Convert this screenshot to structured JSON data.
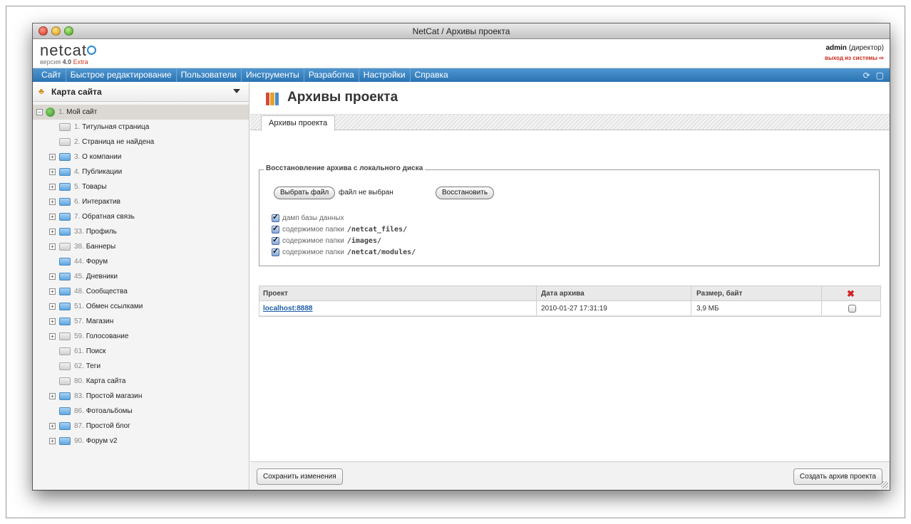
{
  "window": {
    "title": "NetCat / Архивы проекта"
  },
  "header": {
    "logo_text": "netcat",
    "version_prefix": "версия",
    "version_number": "4.0",
    "version_edition": "Extra",
    "user_name": "admin",
    "user_role": "(директор)",
    "logout_label": "выход из системы"
  },
  "menu": {
    "items": [
      "Сайт",
      "Быстрое редактирование",
      "Пользователи",
      "Инструменты",
      "Разработка",
      "Настройки",
      "Справка"
    ],
    "icons": [
      "refresh-icon",
      "chat-icon"
    ]
  },
  "sidebar": {
    "title": "Карта сайта",
    "root": {
      "num": "1.",
      "label": "Мой сайт"
    },
    "items": [
      {
        "num": "1.",
        "label": "Титульная страница",
        "expandable": false,
        "color": "gray"
      },
      {
        "num": "2.",
        "label": "Страница не найдена",
        "expandable": false,
        "color": "gray"
      },
      {
        "num": "3.",
        "label": "О компании",
        "expandable": true,
        "color": "blue"
      },
      {
        "num": "4.",
        "label": "Публикации",
        "expandable": true,
        "color": "blue"
      },
      {
        "num": "5.",
        "label": "Товары",
        "expandable": true,
        "color": "blue"
      },
      {
        "num": "6.",
        "label": "Интерактив",
        "expandable": true,
        "color": "blue"
      },
      {
        "num": "7.",
        "label": "Обратная связь",
        "expandable": true,
        "color": "blue"
      },
      {
        "num": "33.",
        "label": "Профиль",
        "expandable": true,
        "color": "blue"
      },
      {
        "num": "38.",
        "label": "Баннеры",
        "expandable": true,
        "color": "gray"
      },
      {
        "num": "44.",
        "label": "Форум",
        "expandable": false,
        "color": "blue"
      },
      {
        "num": "45.",
        "label": "Дневники",
        "expandable": true,
        "color": "blue"
      },
      {
        "num": "48.",
        "label": "Сообщества",
        "expandable": true,
        "color": "blue"
      },
      {
        "num": "51.",
        "label": "Обмен ссылками",
        "expandable": true,
        "color": "blue"
      },
      {
        "num": "57.",
        "label": "Магазин",
        "expandable": true,
        "color": "blue"
      },
      {
        "num": "59.",
        "label": "Голосование",
        "expandable": true,
        "color": "gray"
      },
      {
        "num": "61.",
        "label": "Поиск",
        "expandable": false,
        "color": "gray"
      },
      {
        "num": "62.",
        "label": "Теги",
        "expandable": false,
        "color": "gray"
      },
      {
        "num": "80.",
        "label": "Карта сайта",
        "expandable": false,
        "color": "gray"
      },
      {
        "num": "83.",
        "label": "Простой магазин",
        "expandable": true,
        "color": "blue"
      },
      {
        "num": "86.",
        "label": "Фотоальбомы",
        "expandable": false,
        "color": "blue"
      },
      {
        "num": "87.",
        "label": "Простой блог",
        "expandable": true,
        "color": "blue"
      },
      {
        "num": "90.",
        "label": "Форум v2",
        "expandable": true,
        "color": "blue"
      }
    ]
  },
  "main": {
    "page_title": "Архивы проекта",
    "tab_label": "Архивы проекта",
    "restore": {
      "legend": "Восстановление архива с локального диска",
      "choose_file_label": "Выбрать файл",
      "file_status": "файл не выбран",
      "restore_button": "Восстановить",
      "options": [
        {
          "text": "дамп базы данных",
          "path": ""
        },
        {
          "text": "содержимое папки",
          "path": "/netcat_files/"
        },
        {
          "text": "содержимое папки",
          "path": "/images/"
        },
        {
          "text": "содержимое папки",
          "path": "/netcat/modules/"
        }
      ]
    },
    "table": {
      "headers": [
        "Проект",
        "Дата архива",
        "Размер, байт"
      ],
      "rows": [
        {
          "project": "localhost:8888",
          "date": "2010-01-27 17:31:19",
          "size": "3,9 МБ"
        }
      ]
    },
    "footer": {
      "save_label": "Сохранить изменения",
      "create_label": "Создать архив проекта"
    }
  },
  "colors": {
    "menu_blue": "#3683c3",
    "link_blue": "#1f5fa8",
    "logout_red": "#c8281a",
    "extra_red": "#d23a1a"
  }
}
